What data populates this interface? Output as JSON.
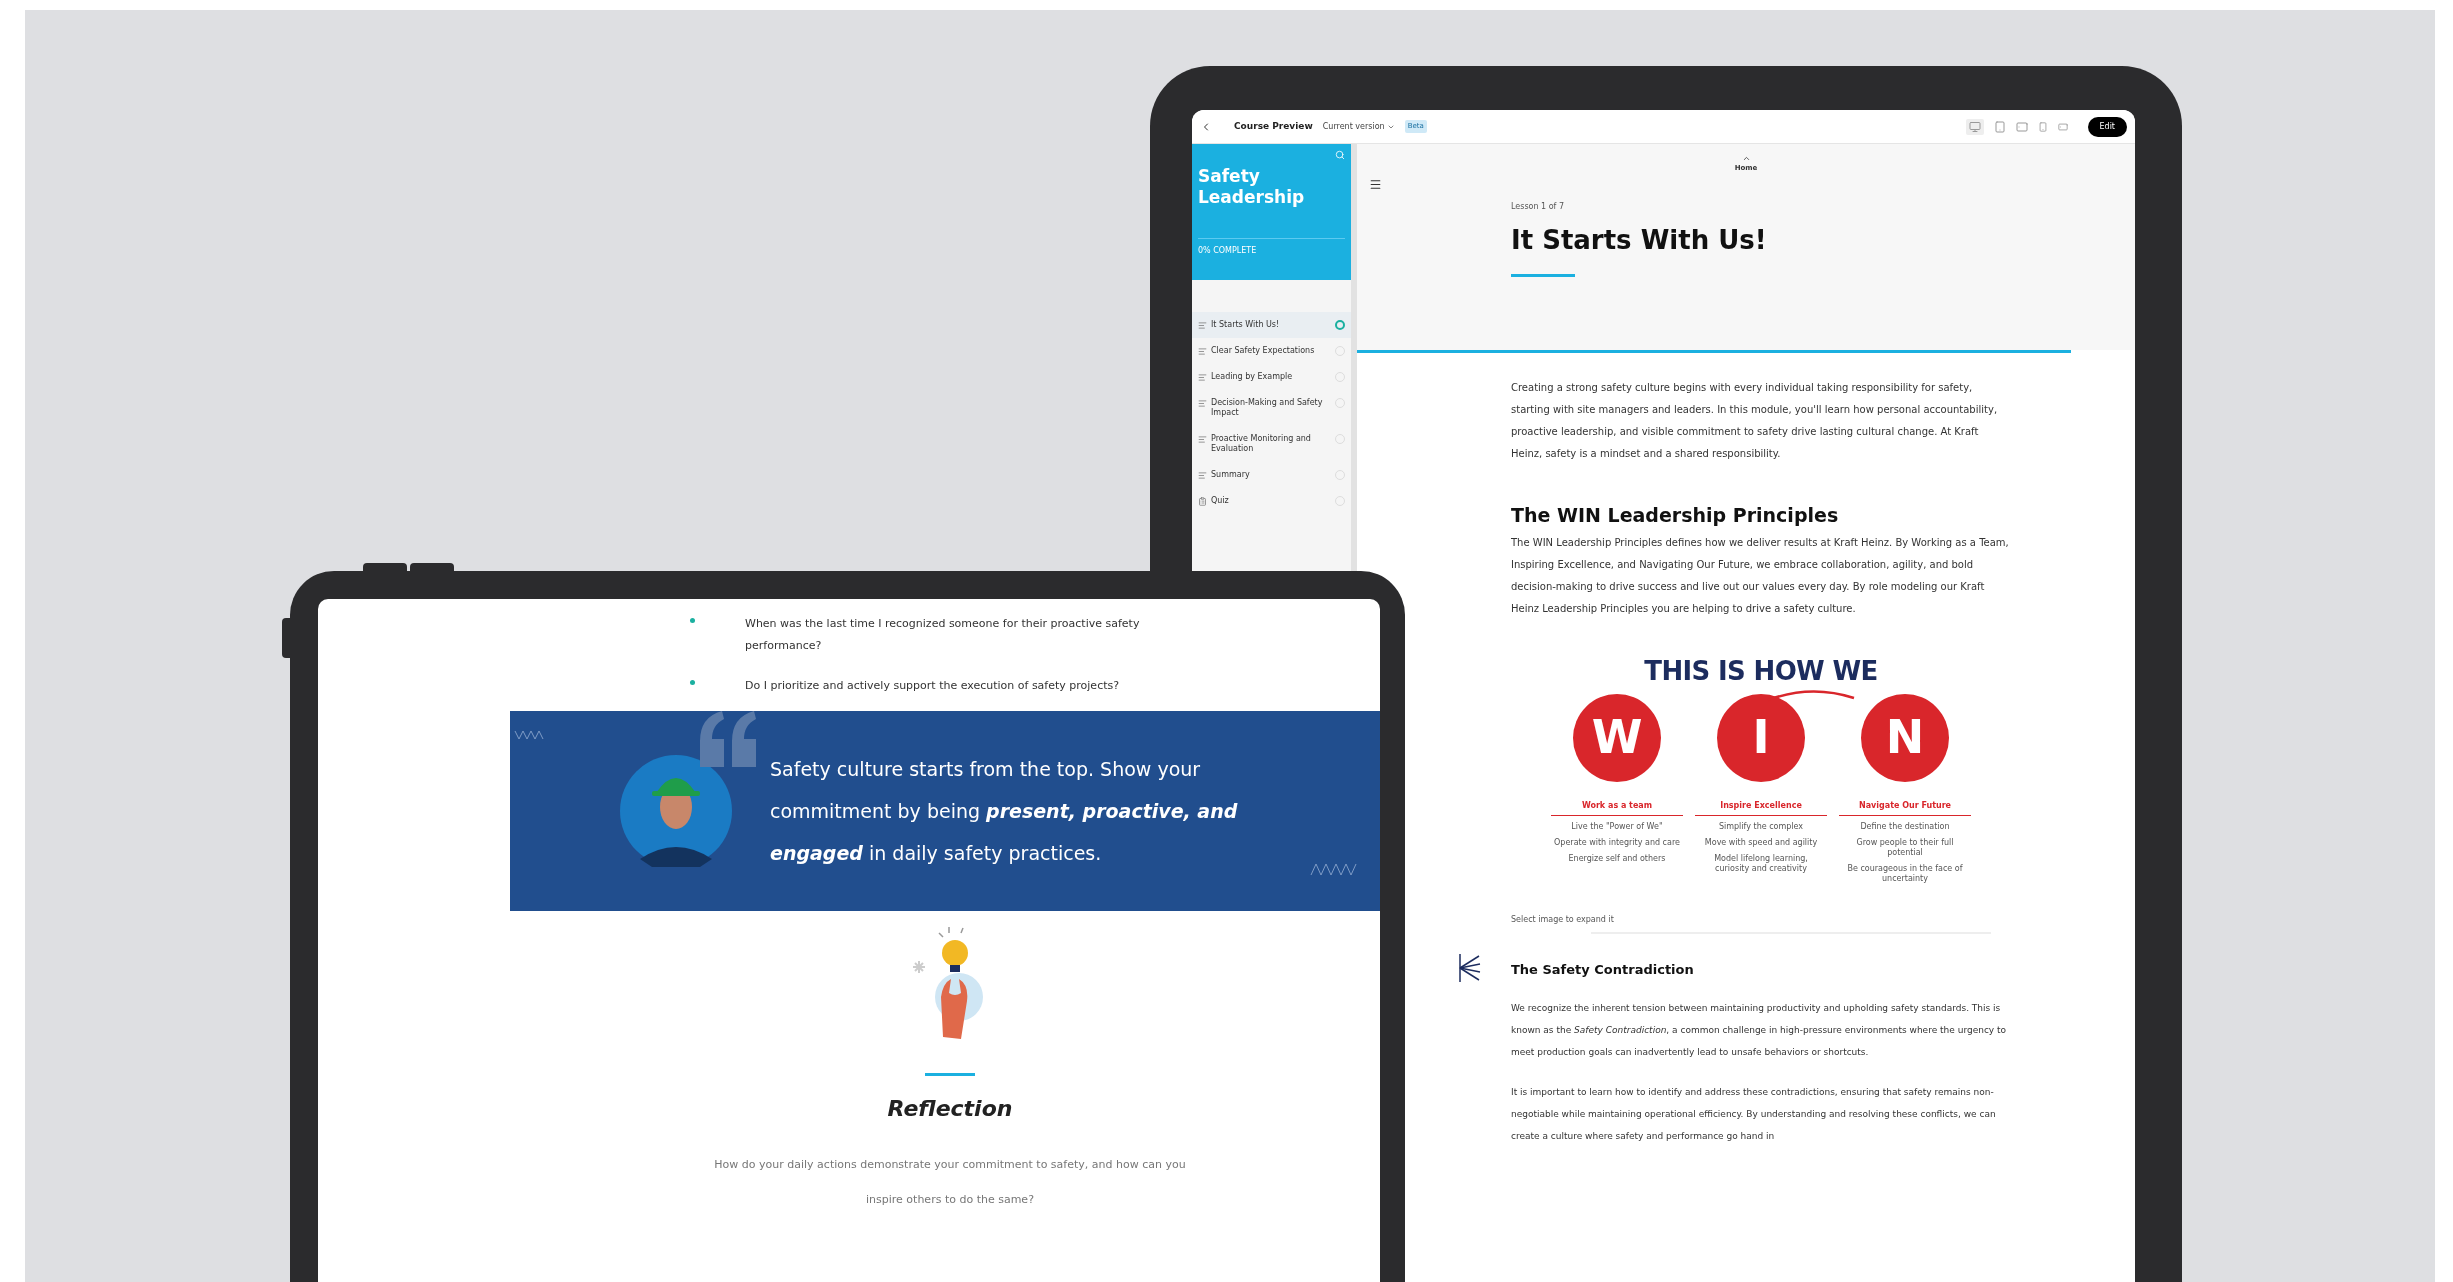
{
  "course_tablet": {
    "top_bar": {
      "title": "Course Preview",
      "version": "Current version",
      "badge": "Beta",
      "edit_button": "Edit"
    },
    "sidebar": {
      "title": "Safety Leadership",
      "progress": "0% COMPLETE",
      "items": [
        {
          "label": "It Starts With Us!",
          "kind": "lesson",
          "selected": true
        },
        {
          "label": "Clear Safety Expectations",
          "kind": "lesson",
          "selected": false
        },
        {
          "label": "Leading by Example",
          "kind": "lesson",
          "selected": false
        },
        {
          "label": "Decision-Making and Safety Impact",
          "kind": "lesson",
          "selected": false
        },
        {
          "label": "Proactive Monitoring and Evaluation",
          "kind": "lesson",
          "selected": false
        },
        {
          "label": "Summary",
          "kind": "lesson",
          "selected": false
        },
        {
          "label": "Quiz",
          "kind": "quiz",
          "selected": false
        }
      ]
    },
    "content": {
      "home": "Home",
      "lesson_label": "Lesson 1 of 7",
      "title": "It Starts With Us!",
      "intro": "Creating a strong safety culture begins with every individual taking responsibility for safety, starting with site managers and leaders. In this module, you'll learn how personal accountability, proactive leadership, and visible commitment to safety drive lasting cultural change. At Kraft Heinz, safety is a mindset and a shared responsibility.",
      "win_heading": "The WIN Leadership Principles",
      "win_text": "The WIN Leadership Principles defines how we deliver results at Kraft Heinz. By Working as a Team, Inspiring Excellence, and Navigating Our Future, we embrace collaboration, agility, and bold decision-making to drive success and live out our values every day.  By role modeling our Kraft Heinz Leadership Principles you are helping to drive a safety culture.",
      "win_graphic": {
        "heading": "THIS IS HOW WE",
        "pillars": [
          {
            "letter": "W",
            "title": "Work as a team",
            "points": [
              "Live the \"Power of We\"",
              "Operate with integrity and care",
              "Energize self and others"
            ]
          },
          {
            "letter": "I",
            "title": "Inspire Excellence",
            "points": [
              "Simplify the complex",
              "Move with speed and agility",
              "Model lifelong learning, curiosity and creativity"
            ]
          },
          {
            "letter": "N",
            "title": "Navigate Our Future",
            "points": [
              "Define the destination",
              "Grow people to their full potential",
              "Be courageous in the face of uncertainty"
            ]
          }
        ]
      },
      "caption": "Select image to expand it",
      "contradiction_heading": "The Safety Contradiction",
      "contradiction_paragraphs": [
        "We recognize the inherent tension between maintaining productivity and upholding safety standards. This is known as the *Safety Contradiction*, a common challenge in high-pressure environments where the urgency to meet production goals can inadvertently lead to unsafe behaviors or shortcuts.",
        "It is important to learn how to identify and address these contradictions, ensuring that safety remains non-negotiable while maintaining operational efficiency. By understanding and resolving these conflicts, we can create a culture where safety and performance go hand in"
      ]
    }
  },
  "reflection_tablet": {
    "bullets": [
      "When was the last time I recognized someone for their proactive safety performance?",
      "Do I prioritize and actively support the execution of safety projects?"
    ],
    "quote": "Safety culture starts from the top. Show your commitment by being **present, proactive, and engaged** in daily safety practices.",
    "reflection_title": "Reflection",
    "question": "How do your daily actions demonstrate your commitment to safety, and how can you inspire others to do the same?"
  }
}
